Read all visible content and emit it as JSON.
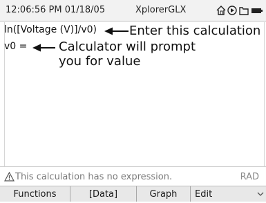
{
  "status_bar": {
    "datetime": "12:06:56 PM 01/18/05",
    "app_name": "XplorerGLX",
    "icons": [
      "home-icon",
      "play-icon",
      "folder-icon",
      "battery-icon"
    ]
  },
  "editor": {
    "lines": [
      "ln([Voltage (V)]/v0)",
      "v0 ="
    ],
    "annotations": {
      "enter_note": "Enter this calculation",
      "prompt_note_line1": "Calculator will prompt",
      "prompt_note_line2": "you for value"
    }
  },
  "message_bar": {
    "icon": "warning-icon",
    "message": "This calculation has no expression.",
    "angle_mode": "RAD"
  },
  "softkeys": [
    "Functions",
    "[Data]",
    "Graph",
    "Edit"
  ],
  "colors": {
    "background": "#ffffff",
    "text": "#111111",
    "status_bar": "#f2f2f2",
    "softkey_bar": "#e8e8e8",
    "muted": "#7a7a7a"
  }
}
